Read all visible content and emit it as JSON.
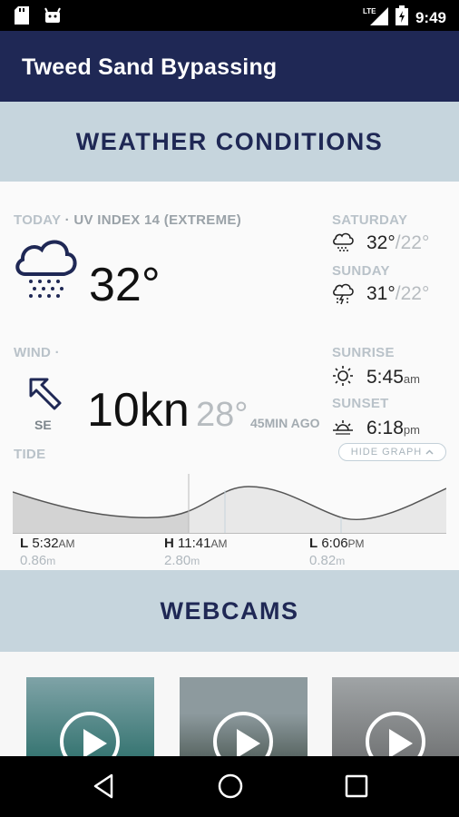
{
  "status_bar": {
    "time": "9:49",
    "network": "LTE",
    "icons": [
      "sd-card-icon",
      "android-icon",
      "signal-icon",
      "battery-icon"
    ]
  },
  "app_bar": {
    "title": "Tweed Sand Bypassing"
  },
  "weather": {
    "header": "WEATHER CONDITIONS",
    "today_label": "TODAY",
    "uv_index": "· UV INDEX 14 (EXTREME)",
    "today_temp": "32°",
    "today_icon": "rain-cloud-icon",
    "forecast": [
      {
        "day": "SATURDAY",
        "high": "32°",
        "low": "/22°",
        "icon": "rain-cloud-icon"
      },
      {
        "day": "SUNDAY",
        "high": "31°",
        "low": "/22°",
        "icon": "thunderstorm-cloud-icon"
      }
    ],
    "wind": {
      "label": "WIND ·",
      "speed": "10kn",
      "degrees": "28°",
      "direction": "SE",
      "updated": "45MIN AGO",
      "icon": "wind-arrow-icon"
    },
    "sunrise": {
      "label": "SUNRISE",
      "time": "5:45",
      "suffix": "am"
    },
    "sunset": {
      "label": "SUNSET",
      "time": "6:18",
      "suffix": "pm"
    },
    "tide": {
      "label": "TIDE",
      "hide_graph_label": "HIDE GRAPH",
      "entries": [
        {
          "type": "L",
          "time": "5:32",
          "suffix": "AM",
          "height": "0.86",
          "unit": "m"
        },
        {
          "type": "H",
          "time": "11:41",
          "suffix": "AM",
          "height": "2.80",
          "unit": "m"
        },
        {
          "type": "L",
          "time": "6:06",
          "suffix": "PM",
          "height": "0.82",
          "unit": "m"
        }
      ]
    }
  },
  "webcams": {
    "header": "WEBCAMS",
    "cams": [
      {
        "name": "webcam-1",
        "color_top": "#7fa3a7",
        "color_bottom": "#2d6f6b"
      },
      {
        "name": "webcam-2",
        "color_top": "#8d9a9e",
        "color_bottom": "#4d5a55"
      },
      {
        "name": "webcam-3",
        "color_top": "#a0a4a6",
        "color_bottom": "#6e7071"
      }
    ]
  },
  "colors": {
    "app_bar": "#1f2855",
    "section_header_bg": "#c6d5dd",
    "section_header_text": "#1f2855"
  }
}
